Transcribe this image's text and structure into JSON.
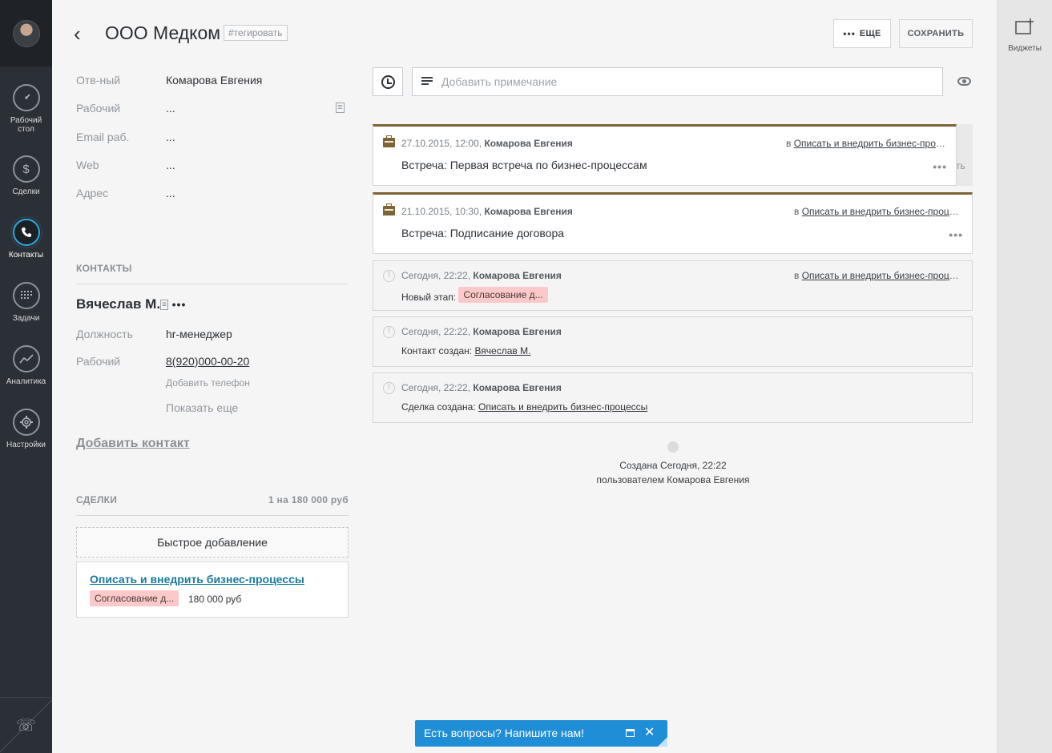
{
  "nav": {
    "items": [
      {
        "label": "Рабочий стол",
        "icon": "dashboard-gauge-icon"
      },
      {
        "label": "Сделки",
        "icon": "dollar-icon"
      },
      {
        "label": "Контакты",
        "icon": "phone-icon"
      },
      {
        "label": "Задачи",
        "icon": "calendar-icon"
      },
      {
        "label": "Аналитика",
        "icon": "chart-line-icon"
      },
      {
        "label": "Настройки",
        "icon": "gear-icon"
      }
    ],
    "active": "Контакты"
  },
  "widgets": {
    "label": "Виджеты",
    "icon": "add-widget-icon"
  },
  "header": {
    "title": "ООО Медком",
    "tag_link": "#тегировать",
    "more_label": "ЕЩЕ",
    "save_label": "СОХРАНИТЬ"
  },
  "company_fields": [
    {
      "label": "Отв-ный",
      "value": "Комарова Евгения"
    },
    {
      "label": "Рабочий",
      "value": "..."
    },
    {
      "label": "Email раб.",
      "value": "..."
    },
    {
      "label": "Web",
      "value": "..."
    },
    {
      "label": "Адрес",
      "value": "..."
    }
  ],
  "contacts": {
    "heading": "КОНТАКТЫ",
    "name": "Вячеслав М.",
    "position_label": "Должность",
    "position_value": "hr-менеджер",
    "phone_label": "Рабочий",
    "phone_value": "8(920)000-00-20",
    "add_phone": "Добавить телефон",
    "show_more": "Показать еще",
    "add_contact": "Добавить контакт"
  },
  "deals": {
    "heading": "СДЕЛКИ",
    "summary": "1 на 180 000 руб",
    "quick_add": "Быстрое добавление",
    "items": [
      {
        "name": "Описать и внедрить бизнес-процессы",
        "stage": "Согласование д...",
        "amount": "180 000 руб"
      }
    ]
  },
  "note": {
    "placeholder": "Добавить примечание"
  },
  "feed": [
    {
      "type": "task",
      "time": "27.10.2015, 12:00,",
      "author": "Комарова Евгения",
      "in_prefix": "в",
      "in_link": "Описать и внедрить бизнес-процессы",
      "body": "Встреча: Первая встреча по бизнес-процессам"
    },
    {
      "type": "task",
      "time": "21.10.2015, 10:30,",
      "author": "Комарова Евгения",
      "in_prefix": "в",
      "in_link": "Описать и внедрить бизнес-процессы",
      "body": "Встреча: Подписание договора"
    },
    {
      "type": "system",
      "time": "Сегодня, 22:22,",
      "author": "Комарова Евгения",
      "in_prefix": "в",
      "in_link": "Описать и внедрить бизнес-процессы",
      "body_prefix": "Новый этап:",
      "stage": "Согласование д..."
    },
    {
      "type": "system",
      "time": "Сегодня, 22:22,",
      "author": "Комарова Евгения",
      "body_prefix": "Контакт создан:",
      "body_link": "Вячеслав М."
    },
    {
      "type": "system",
      "time": "Сегодня, 22:22,",
      "author": "Комарова Евгения",
      "body_prefix": "Сделка создана:",
      "body_link": "Описать и внедрить бизнес-процессы"
    }
  ],
  "stack_hint": "ть",
  "created": {
    "line1": "Создана Сегодня, 22:22",
    "line2": "пользователем Комарова Евгения"
  },
  "chat": {
    "text": "Есть вопросы? Напишите нам!"
  },
  "colors": {
    "nav_bg": "#2b3037",
    "accent_blue": "#2ea7dd",
    "task_brown": "#7d6434",
    "stage_pink": "#fbc9c9",
    "chat_blue": "#1f8ed6",
    "deal_link": "#1a7a9e"
  }
}
